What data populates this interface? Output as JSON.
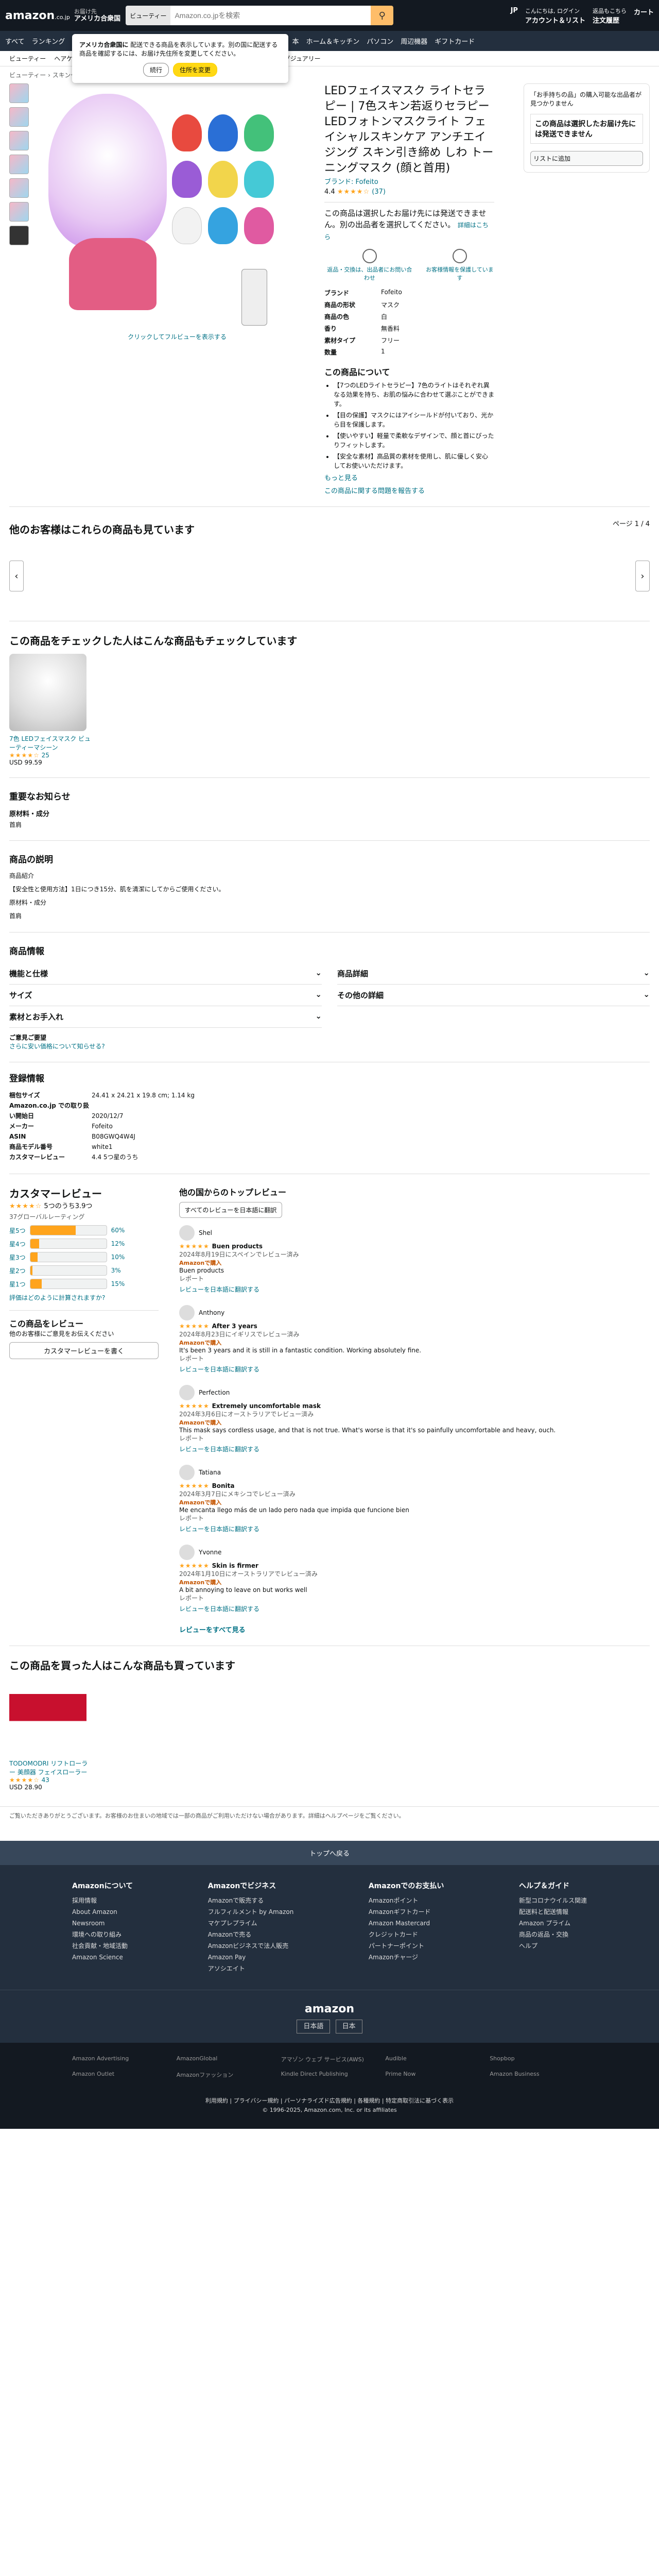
{
  "header": {
    "logo": "amazon",
    "logo_suffix": ".co.jp",
    "deliver_line1": "お届け先",
    "deliver_line2": "アメリカ合衆国",
    "search_category": "ビューティー",
    "search_placeholder": "Amazon.co.jpを検索",
    "lang": "JP",
    "account_line1": "こんにちは, ログイン",
    "account_line2": "アカウント＆リスト",
    "orders_line1": "返品もこちら",
    "orders_line2": "注文履歴",
    "cart": "カート"
  },
  "popup": {
    "title": "アメリカ合衆国に",
    "text": "配送できる商品を表示しています。別の国に配送する商品を確認するには、お届け先住所を変更してください。",
    "btn_continue": "続行",
    "btn_change": "住所を変更"
  },
  "navbar": [
    "すべて",
    "ランキング",
    "Amazon Basics",
    "新着商品",
    "プライム",
    "ギフトカード",
    "タイムセール",
    "本",
    "ホーム＆キッチン",
    "パソコン",
    "周辺機器",
    "ギフトカード"
  ],
  "subnav": [
    "ビューティー",
    "ヘアケア",
    "スキンケア",
    "メイク",
    "ネイル",
    "ボディケア",
    "メンズ",
    "オーラル",
    "ラグジュアリー"
  ],
  "breadcrumb": "ビューティー › スキンケア",
  "product": {
    "title": "LEDフェイスマスク ライトセラピー | 7色スキン若返りセラピーLEDフォトンマスクライト フェイシャルスキンケア アンチエイジング スキン引き締め しわ トーニングマスク (顔と首用)",
    "brand": "ブランド: Fofeito",
    "rating": "4.4",
    "stars": "★★★★☆",
    "rating_count": "(37)",
    "image_caption": "クリックしてフルビューを表示する",
    "unavailable": "この商品は選択したお届け先には発送できません。別の出品者を選択してください。",
    "unavailable_link": "詳細はこちら",
    "icon1": "返品・交換は、出品者にお問い合わせ",
    "icon2": "お客様情報を保護しています",
    "specs": [
      {
        "k": "ブランド",
        "v": "Fofeito"
      },
      {
        "k": "商品の形状",
        "v": "マスク"
      },
      {
        "k": "商品の色",
        "v": "白"
      },
      {
        "k": "香り",
        "v": "無香料"
      },
      {
        "k": "素材タイプ",
        "v": "フリー"
      },
      {
        "k": "数量",
        "v": "1"
      }
    ],
    "about_title": "この商品について",
    "about": [
      "【7つのLEDライトセラピー】7色のライトはそれぞれ異なる効果を持ち、お肌の悩みに合わせて選ぶことができます。",
      "【目の保護】マスクにはアイシールドが付いており、光から目を保護します。",
      "【使いやすい】軽量で柔軟なデザインで、顔と首にぴったりフィットします。",
      "【安全な素材】高品質の素材を使用し、肌に優しく安心してお使いいただけます。"
    ],
    "more": "もっと見る",
    "report": "この商品に関する問題を報告する"
  },
  "buybox": {
    "line1": "「お手持ちの品」の購入可能な出品者が見つかりません",
    "unavail": "この商品は選択したお届け先には発送できません",
    "list_btn": "リストに追加"
  },
  "sections": {
    "also_viewed": "他のお客様はこれらの商品も見ています",
    "page": "ページ 1 / 4",
    "checked": "この商品をチェックした人はこんな商品もチェックしています",
    "card1_title": "7色 LEDフェイスマスク ビューティーマシーン",
    "card1_stars": "★★★★☆",
    "card1_count": "25",
    "card1_price": "USD 99.59",
    "notice_title": "重要なお知らせ",
    "notice_sub": "原材料・成分",
    "notice_body": "首肩",
    "desc_title": "商品の説明",
    "desc_p1": "商品紹介",
    "desc_p2": "【安全性と使用方法】1日につき15分、肌を清潔にしてからご使用ください。",
    "desc_p3": "原材料・成分",
    "desc_p4": "首肩",
    "info_title": "商品情報",
    "acc_left": [
      "機能と仕様",
      "サイズ",
      "素材とお手入れ"
    ],
    "acc_right": [
      "商品詳細",
      "その他の詳細"
    ],
    "feedback": "ご意見ご要望",
    "feedback_link": "さらに安い価格について知らせる?",
    "reg_title": "登録情報",
    "reg": [
      {
        "k": "梱包サイズ",
        "v": "24.41 x 24.21 x 19.8 cm; 1.14 kg"
      },
      {
        "k": "Amazon.co.jp での取り扱い開始日",
        "v": "2020/12/7"
      },
      {
        "k": "メーカー",
        "v": "Fofeito"
      },
      {
        "k": "ASIN",
        "v": "B08GWQ4W4J"
      },
      {
        "k": "商品モデル番号",
        "v": "white1"
      },
      {
        "k": "カスタマーレビュー",
        "v": "4.4 5つ星のうち"
      }
    ],
    "bought_title": "この商品を買った人はこんな商品も買っています",
    "card2_title": "TODOMODRI リフトローラー 美顔器 フェイスローラー",
    "card2_stars": "★★★★☆",
    "card2_count": "43",
    "card2_price": "USD 28.90"
  },
  "reviews": {
    "title": "カスタマーレビュー",
    "avg": "5つのうち3.9つ",
    "total": "37グローバルレーティング",
    "hist": [
      {
        "label": "星5つ",
        "pct": 60,
        "txt": "60%"
      },
      {
        "label": "星4つ",
        "pct": 12,
        "txt": "12%"
      },
      {
        "label": "星3つ",
        "pct": 10,
        "txt": "10%"
      },
      {
        "label": "星2つ",
        "pct": 3,
        "txt": "3%"
      },
      {
        "label": "星1つ",
        "pct": 15,
        "txt": "15%"
      }
    ],
    "how": "評価はどのように計算されますか?",
    "write_title": "この商品をレビュー",
    "write_sub": "他のお客様にご意見をお伝えください",
    "write_btn": "カスタマーレビューを書く",
    "top_title": "他の国からのトップレビュー",
    "translate": "すべてのレビューを日本語に翻訳",
    "items": [
      {
        "name": "Shel",
        "title": "Buen products",
        "date": "2024年8月19日にスペインでレビュー済み",
        "body": "Buen products"
      },
      {
        "name": "Anthony",
        "title": "After 3 years",
        "date": "2024年8月23日にイギリスでレビュー済み",
        "body": "It's been 3 years and it is still in a fantastic condition. Working absolutely fine."
      },
      {
        "name": "Perfection",
        "title": "Extremely uncomfortable mask",
        "date": "2024年3月6日にオーストラリアでレビュー済み",
        "body": "This mask says cordless usage, and that is not true. What's worse is that it's so painfully uncomfortable and heavy, ouch."
      },
      {
        "name": "Tatiana",
        "title": "Bonita",
        "date": "2024年3月7日にメキシコでレビュー済み",
        "body": "Me encanta llego más de un lado pero nada que impida que funcione bien"
      },
      {
        "name": "Yvonne",
        "title": "Skin is firmer",
        "date": "2024年1月10日にオーストラリアでレビュー済み",
        "body": "A bit annoying to leave on but works well"
      }
    ],
    "vp": "Amazonで購入",
    "helpful": "レビューを日本語に翻訳する",
    "report": "レポート",
    "all": "レビューをすべて見る"
  },
  "footer": {
    "back_top": "トップへ戻る",
    "cols": [
      {
        "title": "Amazonについて",
        "items": [
          "採用情報",
          "About Amazon",
          "Newsroom",
          "環境への取り組み",
          "社会貢献・地域活動",
          "Amazon Science"
        ]
      },
      {
        "title": "Amazonでビジネス",
        "items": [
          "Amazonで販売する",
          "フルフィルメント by Amazon",
          "マケプレプライム",
          "Amazonで売る",
          "Amazonビジネスで法人販売",
          "Amazon Pay",
          "アソシエイト"
        ]
      },
      {
        "title": "Amazonでのお支払い",
        "items": [
          "Amazonポイント",
          "Amazonギフトカード",
          "Amazon Mastercard",
          "クレジットカード",
          "パートナーポイント",
          "Amazonチャージ"
        ]
      },
      {
        "title": "ヘルプ＆ガイド",
        "items": [
          "新型コロナウイルス関連",
          "配送料と配送情報",
          "Amazon プライム",
          "商品の返品・交換",
          "ヘルプ"
        ]
      }
    ],
    "lang": "日本語",
    "country": "日本",
    "copyright": "© 1996-2025, Amazon.com, Inc. or its affiliates",
    "mini": [
      "Amazon Advertising",
      "AmazonGlobal",
      "アマゾン ウェブ サービス(AWS)",
      "Audible",
      "Shopbop",
      "Amazon Outlet",
      "Amazonファッション",
      "Kindle Direct Publishing",
      "Prime Now",
      "Amazon Business"
    ],
    "legal": "利用規約 | プライバシー規約 | パーソナライズド広告規約 | 各種規約 | 特定商取引法に基づく表示"
  },
  "disclaimer": "ご覧いただきありがとうございます。お客様のお住まいの地域では一部の商品がご利用いただけない場合があります。詳細はヘルプページをご覧ください。"
}
